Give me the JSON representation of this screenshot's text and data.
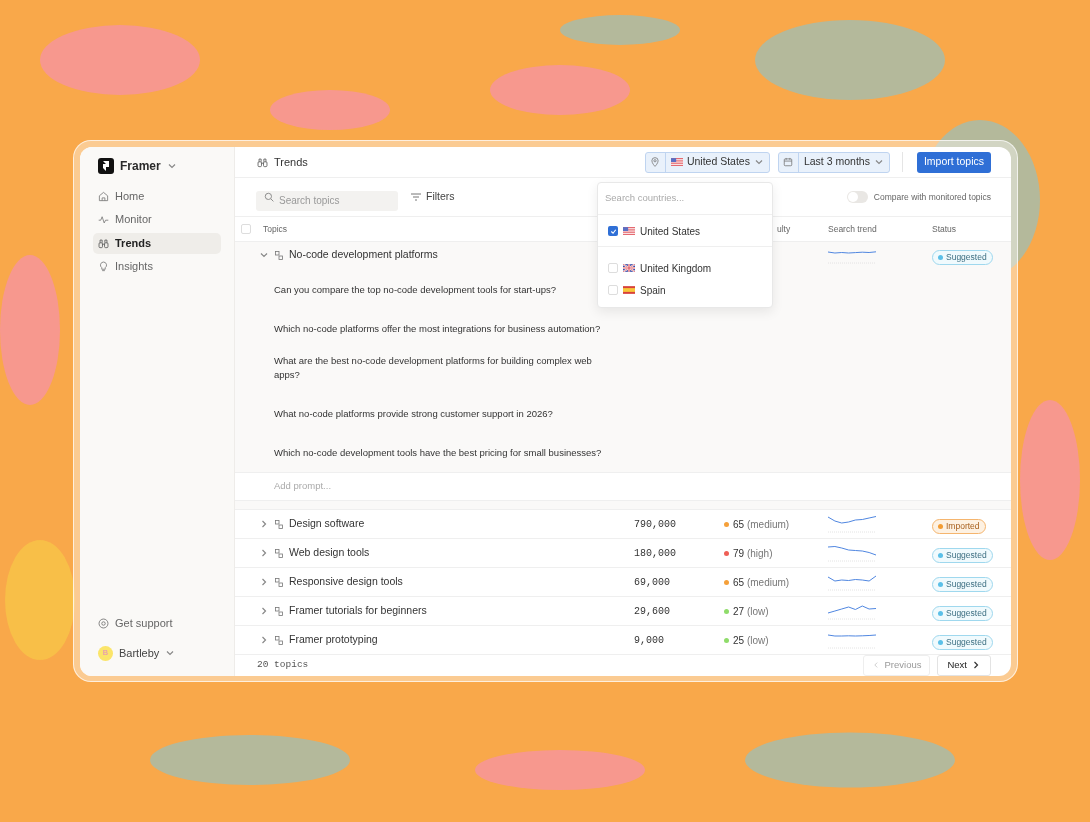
{
  "app": {
    "name": "Framer"
  },
  "sidebar": {
    "items": [
      {
        "label": "Home",
        "selected": false
      },
      {
        "label": "Monitor",
        "selected": false
      },
      {
        "label": "Trends",
        "selected": true
      },
      {
        "label": "Insights",
        "selected": false
      }
    ],
    "support": "Get support",
    "user": {
      "initial": "B",
      "name": "Bartleby"
    }
  },
  "header": {
    "title": "Trends",
    "country": "United States",
    "date_range": "Last 3 months",
    "import_button": "Import topics"
  },
  "toolbar": {
    "search": {
      "placeholder": "Search topics"
    },
    "filters": "Filters",
    "compare_toggle": {
      "label": "Compare with monitored topics",
      "on": false
    }
  },
  "table": {
    "select_all": {
      "checked": false
    },
    "columns": [
      "Topics",
      "ulty",
      "Search trend",
      "Status"
    ],
    "rows": [
      {
        "topic": "No-code development platforms",
        "expanded": true,
        "status": {
          "label": "Suggested",
          "kind": "suggested"
        },
        "prompts": [
          "Can you compare the top no-code development tools for start-ups?",
          "Which no-code platforms offer the most integrations for business automation?",
          "What are the best no-code development platforms for building complex web apps?",
          "What no-code platforms provide strong customer support in 2026?",
          "Which no-code development tools have the best pricing for small businesses?"
        ],
        "add_prompt": {
          "placeholder": "Add prompt..."
        }
      },
      {
        "topic": "Design software",
        "expanded": false,
        "volume": "790,000",
        "difficulty": {
          "score": "65",
          "label": "(medium)",
          "color": "#f5a03a"
        },
        "status": {
          "label": "Imported",
          "kind": "imported"
        }
      },
      {
        "topic": "Web design tools",
        "expanded": false,
        "volume": "180,000",
        "difficulty": {
          "score": "79",
          "label": "(high)",
          "color": "#ef5f56"
        },
        "status": {
          "label": "Suggested",
          "kind": "suggested"
        }
      },
      {
        "topic": "Responsive design tools",
        "expanded": false,
        "volume": "69,000",
        "difficulty": {
          "score": "65",
          "label": "(medium)",
          "color": "#f5a03a"
        },
        "status": {
          "label": "Suggested",
          "kind": "suggested"
        }
      },
      {
        "topic": "Framer tutorials for beginners",
        "expanded": false,
        "volume": "29,600",
        "difficulty": {
          "score": "27",
          "label": "(low)",
          "color": "#8fdc6a"
        },
        "status": {
          "label": "Suggested",
          "kind": "suggested"
        }
      },
      {
        "topic": "Framer prototyping",
        "expanded": false,
        "volume": "9,000",
        "difficulty": {
          "score": "25",
          "label": "(low)",
          "color": "#8fdc6a"
        },
        "status": {
          "label": "Suggested",
          "kind": "suggested"
        }
      }
    ]
  },
  "footer": {
    "count": "20 topics",
    "previous": {
      "label": "Previous",
      "disabled": true
    },
    "next": {
      "label": "Next",
      "disabled": false
    }
  },
  "country_dropdown": {
    "search": {
      "placeholder": "Search countries..."
    },
    "options": [
      {
        "name": "United States",
        "kind": "us",
        "checked": true
      },
      {
        "name": "United Kingdom",
        "kind": "uk",
        "checked": false
      },
      {
        "name": "Spain",
        "kind": "es",
        "checked": false
      }
    ]
  }
}
